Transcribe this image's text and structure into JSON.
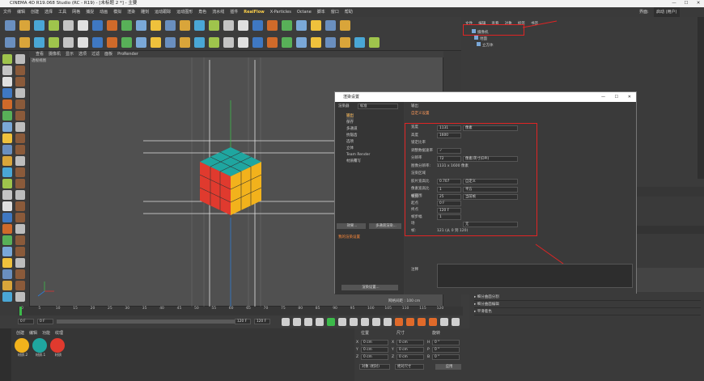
{
  "app": {
    "title": "CINEMA 4D R19.068 Studio (RC - R19) - [未标题 2 *] - 主要"
  },
  "menubar": {
    "items": [
      "文件",
      "编辑",
      "创建",
      "选择",
      "工具",
      "网格",
      "捕捉",
      "动画",
      "模拟",
      "渲染",
      "雕刻",
      "运动跟踪",
      "运动图形",
      "角色",
      "流水线",
      "插件",
      "RealFlow",
      "X-Particles",
      "Octane",
      "脚本",
      "窗口",
      "帮助"
    ],
    "layout_label": "界面:",
    "layout_value": "启动 (用户)"
  },
  "viewport": {
    "menu": [
      "查看",
      "摄像机",
      "显示",
      "选项",
      "过滤",
      "面板",
      "ProRender"
    ],
    "label": "透视视图",
    "grid_spacing": "网格间距 : 100 cm"
  },
  "object_manager": {
    "tabs": [
      "文件",
      "编辑",
      "查看",
      "对象",
      "标签",
      "书签"
    ],
    "objects": [
      "摄像机",
      "地面",
      "立方体"
    ]
  },
  "dialog": {
    "title": "渲染设置",
    "renderer_label": "渲染器",
    "renderer_value": "标准",
    "left_items": [
      "输出",
      "保存",
      "多通道",
      "抗锯齿",
      "选项",
      "立体",
      "Team Render",
      "材质覆写"
    ],
    "btn_effect": "效果...",
    "btn_multipass": "多通道渲染...",
    "preset": "我的渲染设置",
    "btn_render_settings": "渲染设置...",
    "section": "输出",
    "preset_label": "自定义设置",
    "fields": [
      {
        "label": "宽度",
        "value": "1131",
        "unit": "像素"
      },
      {
        "label": "高度",
        "value": "1600",
        "unit": ""
      },
      {
        "label": "锁定比率",
        "value": "",
        "unit": ""
      },
      {
        "label": "调整数据速率",
        "value": "✓",
        "unit": ""
      },
      {
        "label": "分辨率",
        "value": "72",
        "unit": "像素/英寸(DPI)"
      },
      {
        "label": "图像分辨率:",
        "value": "1131 x 1600 像素",
        "unit": ""
      },
      {
        "label": "渲染区域",
        "value": "",
        "unit": ""
      },
      {
        "label": "胶片宽高比",
        "value": "0.707",
        "unit": "自定义"
      },
      {
        "label": "像素宽高比",
        "value": "1",
        "unit": "平方"
      },
      {
        "label": "帧频",
        "value": "25",
        "unit": ""
      },
      {
        "label": "帧范围",
        "value": "",
        "unit": "当前帧"
      },
      {
        "label": "起点",
        "value": "0 F",
        "unit": ""
      },
      {
        "label": "终点",
        "value": "120 F",
        "unit": ""
      },
      {
        "label": "帧步幅",
        "value": "1",
        "unit": ""
      },
      {
        "label": "场",
        "value": "",
        "unit": "无"
      },
      {
        "label": "帧:",
        "value": "121 (从 0 到 120)",
        "unit": ""
      }
    ],
    "notes_label": "注释"
  },
  "timeline": {
    "ticks": [
      "0",
      "5",
      "10",
      "15",
      "20",
      "25",
      "30",
      "35",
      "40",
      "45",
      "50",
      "55",
      "60",
      "65",
      "70",
      "75",
      "80",
      "85",
      "90",
      "95",
      "100",
      "105",
      "110",
      "115",
      "120"
    ],
    "start": "0 F",
    "current": "0 F",
    "end_a": "120 F",
    "end_b": "120 F"
  },
  "materials": {
    "menu": [
      "创建",
      "编辑",
      "功能",
      "纹理"
    ],
    "items": [
      {
        "name": "材质.2",
        "color": "#f2b21c"
      },
      {
        "name": "材质.1",
        "color": "#1fa6a0"
      },
      {
        "name": "材质",
        "color": "#e03a2e"
      }
    ]
  },
  "coords": {
    "headers": [
      "位置",
      "尺寸",
      "旋转"
    ],
    "rows": [
      [
        "X",
        "0 cm",
        "X",
        "0 cm",
        "H",
        "0 °"
      ],
      [
        "Y",
        "0 cm",
        "Y",
        "0 cm",
        "P",
        "0 °"
      ],
      [
        "Z",
        "0 cm",
        "Z",
        "0 cm",
        "B",
        "0 °"
      ]
    ],
    "mode_a": "对象 (相对)",
    "mode_b": "绝对尺寸",
    "apply": "应用"
  },
  "attr_rows": [
    "▸ 细分曲面分割",
    "▸ 细分曲面编辑",
    "▸ 平滑着色"
  ],
  "colors": {
    "accent_red": "#e02424",
    "cube_red": "#e03a2e",
    "cube_yellow": "#f2b21c",
    "cube_teal": "#1fa6a0"
  }
}
